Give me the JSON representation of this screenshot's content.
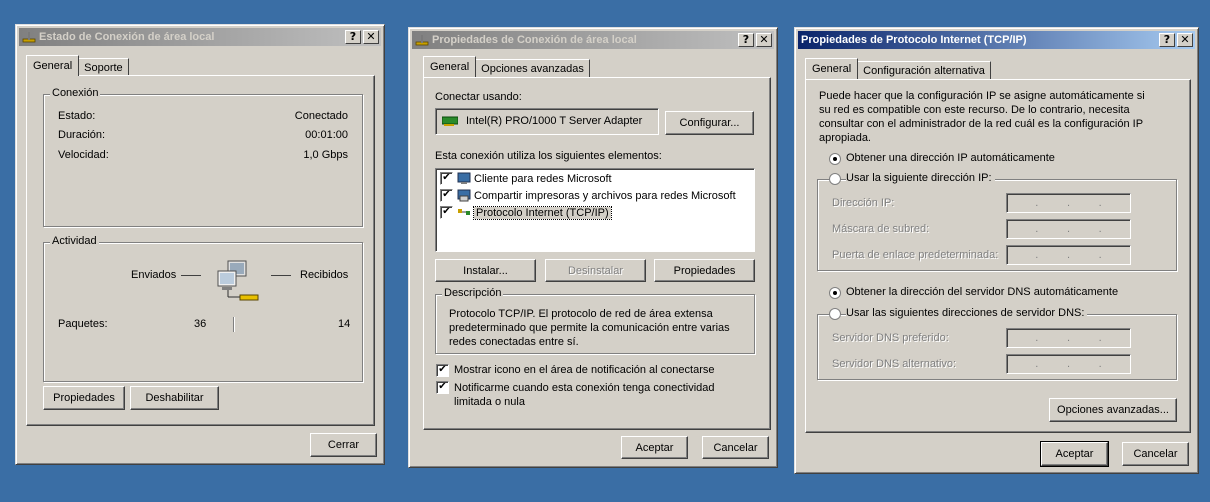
{
  "win1": {
    "title": "Estado de Conexión de área local",
    "tabs": [
      "General",
      "Soporte"
    ],
    "connection_group": "Conexión",
    "rows": [
      {
        "label": "Estado:",
        "value": "Conectado"
      },
      {
        "label": "Duración:",
        "value": "00:01:00"
      },
      {
        "label": "Velocidad:",
        "value": "1,0 Gbps"
      }
    ],
    "activity_group": "Actividad",
    "sent_label": "Enviados",
    "received_label": "Recibidos",
    "packets_label": "Paquetes:",
    "packets_sent": "36",
    "packets_received": "14",
    "properties_button": "Propiedades",
    "disable_button": "Deshabilitar",
    "close_button": "Cerrar"
  },
  "win2": {
    "title": "Propiedades de Conexión de área local",
    "tabs": [
      "General",
      "Opciones avanzadas"
    ],
    "connect_using_label": "Conectar usando:",
    "adapter_name": "Intel(R) PRO/1000 T Server Adapter",
    "configure_button": "Configurar...",
    "elements_label": "Esta conexión utiliza los siguientes elementos:",
    "elements": [
      {
        "label": "Cliente para redes Microsoft",
        "checked": true,
        "icon": "network-client-icon"
      },
      {
        "label": "Compartir impresoras y archivos para redes Microsoft",
        "checked": true,
        "icon": "file-printer-sharing-icon"
      },
      {
        "label": "Protocolo Internet (TCP/IP)",
        "checked": true,
        "icon": "protocol-icon"
      }
    ],
    "install_button": "Instalar...",
    "uninstall_button": "Desinstalar",
    "properties_button": "Propiedades",
    "description_group": "Descripción",
    "description_text": "Protocolo TCP/IP. El protocolo de red de área extensa predeterminado que permite la comunicación entre varias redes conectadas entre sí.",
    "show_icon_label": "Mostrar icono en el área de notificación al conectarse",
    "notify_label": "Notificarme cuando esta conexión tenga conectividad limitada o nula",
    "ok_button": "Aceptar",
    "cancel_button": "Cancelar"
  },
  "win3": {
    "title": "Propiedades de Protocolo Internet (TCP/IP)",
    "tabs": [
      "General",
      "Configuración alternativa"
    ],
    "intro_text": "Puede hacer que la configuración IP se asigne automáticamente si su red es compatible con este recurso. De lo contrario, necesita consultar con el administrador de la red cuál es la configuración IP apropiada.",
    "ip_auto_label": "Obtener una dirección IP automáticamente",
    "ip_manual_label": "Usar la siguiente dirección IP:",
    "ip_address_label": "Dirección IP:",
    "subnet_label": "Máscara de subred:",
    "gateway_label": "Puerta de enlace predeterminada:",
    "dns_auto_label": "Obtener la dirección del servidor DNS automáticamente",
    "dns_manual_label": "Usar las siguientes direcciones de servidor DNS:",
    "dns_preferred_label": "Servidor DNS preferido:",
    "dns_alternate_label": "Servidor DNS alternativo:",
    "advanced_button": "Opciones avanzadas...",
    "ok_button": "Aceptar",
    "cancel_button": "Cancelar"
  },
  "titlebar_buttons": {
    "help": "?",
    "close": "✕"
  },
  "checkmark": "✔",
  "ip_dot": "."
}
